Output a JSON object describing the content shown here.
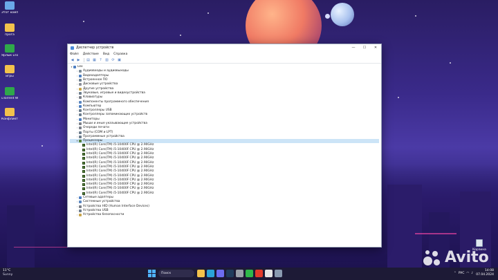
{
  "desktop": {
    "icons": [
      {
        "label": "Этот компьютер",
        "icon": "computer-icon",
        "color": "#6aa8e8"
      },
      {
        "label": "прога",
        "icon": "folder-icon",
        "color": "#f2c24c"
      },
      {
        "label": "Ярлык uTorrent",
        "icon": "utorrent-icon",
        "color": "#2fa84a"
      },
      {
        "label": "игры",
        "icon": "folder-icon",
        "color": "#f2c24c"
      },
      {
        "label": "uTorrent Web",
        "icon": "utorrent-icon",
        "color": "#2fa84a"
      },
      {
        "label": "Конфликт",
        "icon": "folder-icon",
        "color": "#f2c24c"
      }
    ],
    "recycle_bin_label": "Корзина"
  },
  "window": {
    "title": "Диспетчер устройств",
    "controls": {
      "minimize": "—",
      "maximize": "☐",
      "close": "✕"
    },
    "menu": [
      "Файл",
      "Действие",
      "Вид",
      "Справка"
    ],
    "toolbar": [
      {
        "icon": "back-icon",
        "glyph": "◀"
      },
      {
        "icon": "forward-icon",
        "glyph": "▶"
      },
      {
        "icon": "properties-icon",
        "glyph": "▤"
      },
      {
        "icon": "show-hidden-icon",
        "glyph": "▦"
      },
      {
        "icon": "help-icon",
        "glyph": "?"
      },
      {
        "icon": "details-icon",
        "glyph": "▥"
      },
      {
        "icon": "scan-icon",
        "glyph": "⟳"
      },
      {
        "icon": "monitor-icon",
        "glyph": "▣"
      }
    ],
    "tree": {
      "root": "Lex",
      "categories": [
        {
          "label": "Аудиовходы и аудиовыходы",
          "color": "#7a8a98"
        },
        {
          "label": "Видеоадаптеры",
          "color": "#4d7fc2"
        },
        {
          "label": "Встроенное ПО",
          "color": "#6d7f8f"
        },
        {
          "label": "Дисковые устройства",
          "color": "#8b8f99"
        },
        {
          "label": "Другие устройства",
          "color": "#c9a54c"
        },
        {
          "label": "Звуковые, игровые и видеоустройства",
          "color": "#6c7c8c"
        },
        {
          "label": "Клавиатуры",
          "color": "#7a7f88"
        },
        {
          "label": "Компоненты программного обеспечения",
          "color": "#5c87bf"
        },
        {
          "label": "Компьютер",
          "color": "#4d7fc2"
        },
        {
          "label": "Контроллеры USB",
          "color": "#6c7c8c"
        },
        {
          "label": "Контроллеры запоминающих устройств",
          "color": "#6c7c8c"
        },
        {
          "label": "Мониторы",
          "color": "#4d7fc2"
        },
        {
          "label": "Мыши и иные указывающие устройства",
          "color": "#7a7f88"
        },
        {
          "label": "Очереди печати",
          "color": "#7a7f88"
        },
        {
          "label": "Порты (COM и LPT)",
          "color": "#6c7c8c"
        },
        {
          "label": "Программные устройства",
          "color": "#6c7c8c"
        }
      ],
      "processors_label": "Процессоры",
      "processors": [
        "Intel(R) Core(TM) i5-10400F CPU @ 2.90GHz",
        "Intel(R) Core(TM) i5-10400F CPU @ 2.90GHz",
        "Intel(R) Core(TM) i5-10400F CPU @ 2.90GHz",
        "Intel(R) Core(TM) i5-10400F CPU @ 2.90GHz",
        "Intel(R) Core(TM) i5-10400F CPU @ 2.90GHz",
        "Intel(R) Core(TM) i5-10400F CPU @ 2.90GHz",
        "Intel(R) Core(TM) i5-10400F CPU @ 2.90GHz",
        "Intel(R) Core(TM) i5-10400F CPU @ 2.90GHz",
        "Intel(R) Core(TM) i5-10400F CPU @ 2.90GHz",
        "Intel(R) Core(TM) i5-10400F CPU @ 2.90GHz",
        "Intel(R) Core(TM) i5-10400F CPU @ 2.90GHz",
        "Intel(R) Core(TM) i5-10400F CPU @ 2.90GHz"
      ],
      "after": [
        {
          "label": "Сетевые адаптеры",
          "color": "#4d7fc2"
        },
        {
          "label": "Системные устройства",
          "color": "#5c87bf"
        },
        {
          "label": "Устройства HID (Human Interface Devices)",
          "color": "#7a7f88"
        },
        {
          "label": "Устройства USB",
          "color": "#6c7c8c"
        },
        {
          "label": "Устройства безопасности",
          "color": "#c9a54c"
        }
      ]
    }
  },
  "taskbar": {
    "temperature": "11°C",
    "condition": "Sunny",
    "search_placeholder": "Поиск",
    "apps": [
      {
        "icon": "file-explorer-icon",
        "color": "#f2c24c"
      },
      {
        "icon": "edge-icon",
        "color": "#2aa3d8"
      },
      {
        "icon": "store-icon",
        "color": "#6c6cf0"
      },
      {
        "icon": "steam-icon",
        "color": "#1f3b5c"
      },
      {
        "icon": "settings-icon",
        "color": "#9aa0aa"
      },
      {
        "icon": "whatsapp-icon",
        "color": "#2fb84a"
      },
      {
        "icon": "yandex-icon",
        "color": "#e23a2a"
      },
      {
        "icon": "browser-icon",
        "color": "#e6e6e6"
      },
      {
        "icon": "device-manager-icon",
        "color": "#8a9ab0"
      }
    ],
    "tray": {
      "language": "РУС",
      "time": "14:08",
      "date": "07.04.2024"
    }
  },
  "watermark": "Avito"
}
